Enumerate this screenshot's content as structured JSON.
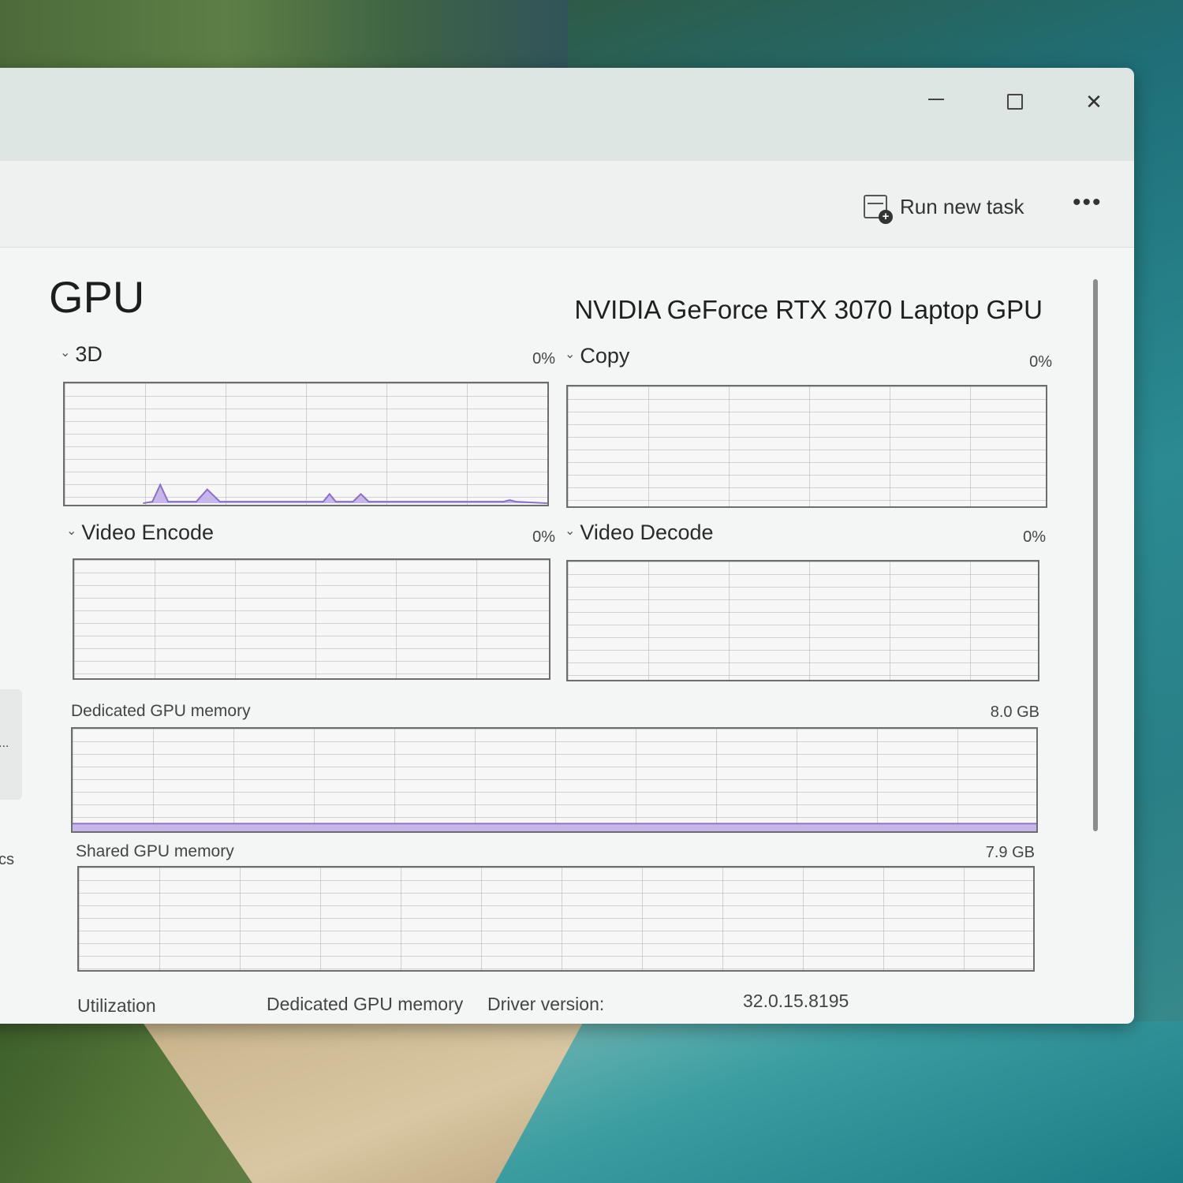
{
  "window": {
    "controls": {
      "minimize": "minimize",
      "maximize": "maximize",
      "close": "close"
    }
  },
  "toolbar": {
    "run_new_task": "Run new task",
    "more": "•••"
  },
  "sidebar": {
    "partial_dots": "...",
    "partial_label": "cs"
  },
  "page": {
    "title": "GPU",
    "gpu_name": "NVIDIA GeForce RTX 3070 Laptop GPU"
  },
  "graphs": {
    "g3d": {
      "label": "3D",
      "value": "0%"
    },
    "copy": {
      "label": "Copy",
      "value": "0%"
    },
    "video_encode": {
      "label": "Video Encode",
      "value": "0%"
    },
    "video_decode": {
      "label": "Video Decode",
      "value": "0%"
    },
    "dedicated_memory": {
      "label": "Dedicated GPU memory",
      "value": "8.0 GB"
    },
    "shared_memory": {
      "label": "Shared GPU memory",
      "value": "7.9 GB"
    }
  },
  "stats": {
    "utilization": "Utilization",
    "dedicated": "Dedicated GPU memory",
    "driver_version_label": "Driver version:",
    "driver_version_value": "32.0.15.8195"
  },
  "colors": {
    "graph_line": "#8a6fc9",
    "graph_fill": "#c7b6ea",
    "window_bg": "#f3f5f4"
  }
}
